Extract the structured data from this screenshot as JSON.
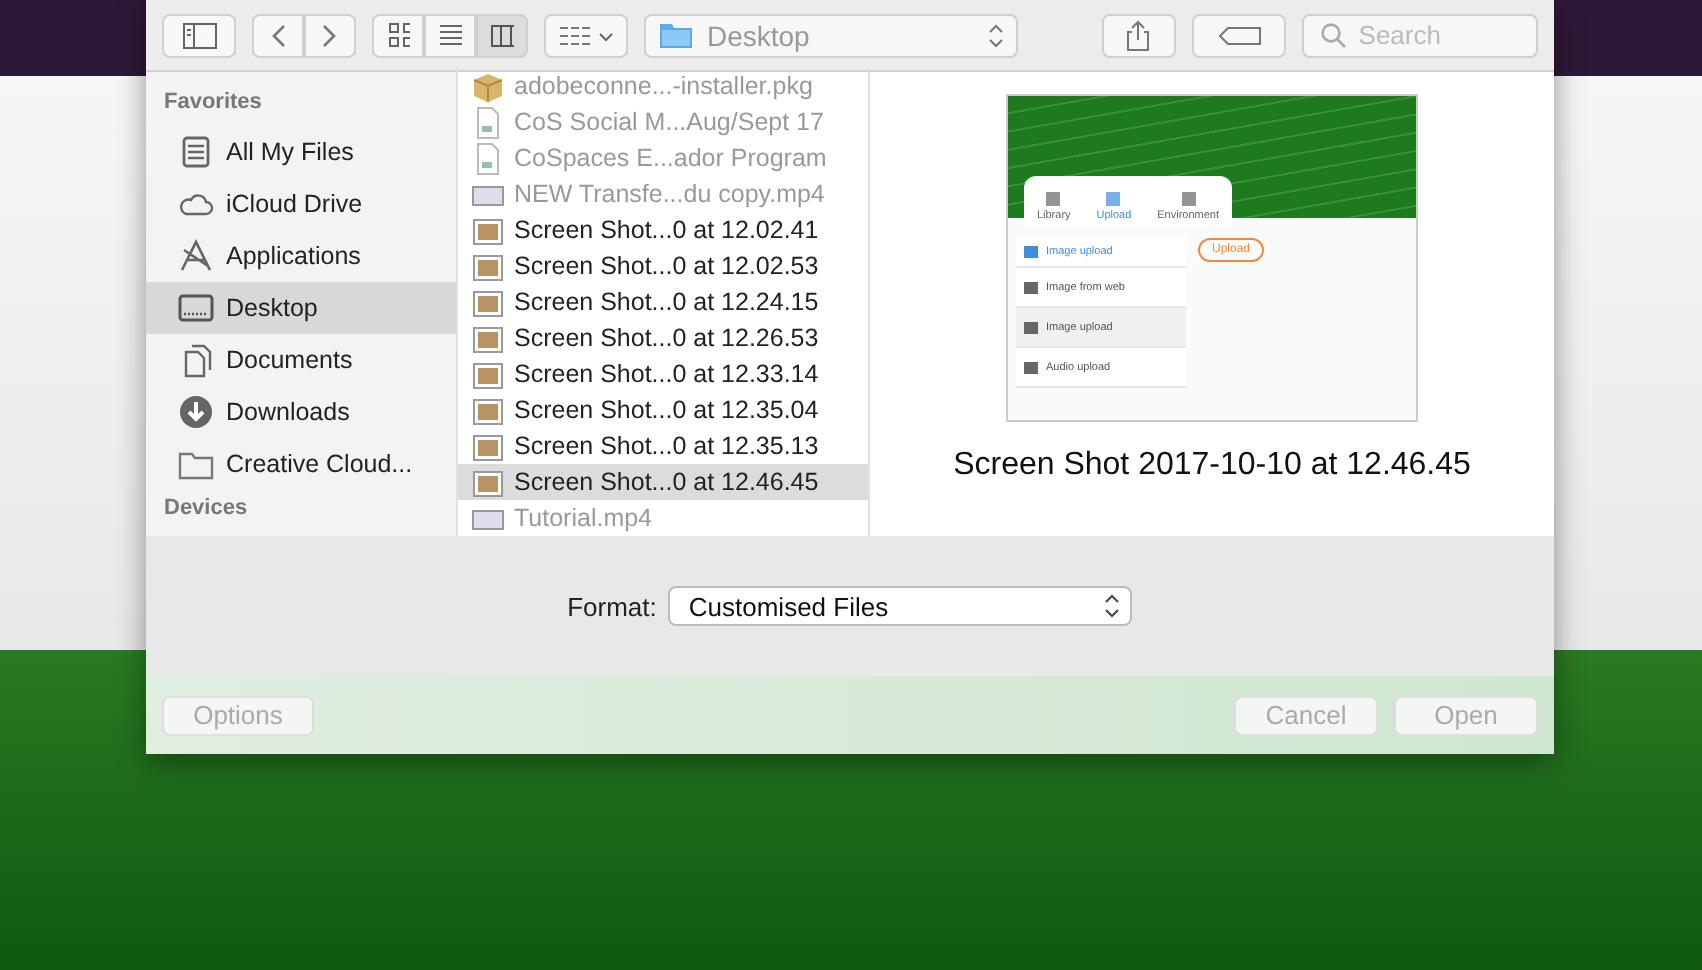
{
  "toolbar": {
    "location": "Desktop",
    "search_placeholder": "Search",
    "view_modes": [
      {
        "kind": "icons",
        "selected": false
      },
      {
        "kind": "list",
        "selected": false
      },
      {
        "kind": "columns",
        "selected": true
      }
    ]
  },
  "sidebar": {
    "sections": [
      {
        "heading": "Favorites",
        "items": [
          {
            "label": "All My Files",
            "kind": "files",
            "selected": false
          },
          {
            "label": "iCloud Drive",
            "kind": "cloud",
            "selected": false
          },
          {
            "label": "Applications",
            "kind": "apps",
            "selected": false
          },
          {
            "label": "Desktop",
            "kind": "desktop",
            "selected": true
          },
          {
            "label": "Documents",
            "kind": "docs",
            "selected": false
          },
          {
            "label": "Downloads",
            "kind": "download",
            "selected": false
          },
          {
            "label": "Creative Cloud...",
            "kind": "folder",
            "selected": false
          }
        ]
      },
      {
        "heading": "Devices"
      }
    ]
  },
  "files": [
    {
      "name": "adobeconne...-installer.pkg",
      "kind": "package",
      "disabled": true,
      "selected": false
    },
    {
      "name": "CoS Social M...Aug/Sept 17",
      "kind": "doc",
      "disabled": true,
      "selected": false
    },
    {
      "name": "CoSpaces E...ador Program",
      "kind": "doc",
      "disabled": true,
      "selected": false
    },
    {
      "name": "NEW Transfe...du copy.mp4",
      "kind": "video",
      "disabled": true,
      "selected": false
    },
    {
      "name": "Screen Shot...0 at 12.02.41",
      "kind": "image",
      "disabled": false,
      "selected": false
    },
    {
      "name": "Screen Shot...0 at 12.02.53",
      "kind": "image",
      "disabled": false,
      "selected": false
    },
    {
      "name": "Screen Shot...0 at 12.24.15",
      "kind": "image",
      "disabled": false,
      "selected": false
    },
    {
      "name": "Screen Shot...0 at 12.26.53",
      "kind": "image",
      "disabled": false,
      "selected": false
    },
    {
      "name": "Screen Shot...0 at 12.33.14",
      "kind": "image",
      "disabled": false,
      "selected": false
    },
    {
      "name": "Screen Shot...0 at 12.35.04",
      "kind": "image",
      "disabled": false,
      "selected": false
    },
    {
      "name": "Screen Shot...0 at 12.35.13",
      "kind": "image",
      "disabled": false,
      "selected": false
    },
    {
      "name": "Screen Shot...0 at 12.46.45",
      "kind": "image",
      "disabled": false,
      "selected": true
    },
    {
      "name": "Tutorial.mp4",
      "kind": "video",
      "disabled": true,
      "selected": false
    }
  ],
  "preview": {
    "title": "Screen Shot 2017-10-10 at 12.46.45",
    "screenshot": {
      "tabs": [
        {
          "label": "Library",
          "selected": false
        },
        {
          "label": "Upload",
          "selected": true
        },
        {
          "label": "Environment",
          "selected": false
        }
      ],
      "menu_header": "Image upload",
      "upload_button": "Upload",
      "menu_items": [
        {
          "label": "Image from web",
          "selected": false
        },
        {
          "label": "Image upload",
          "selected": true
        },
        {
          "label": "Audio upload",
          "selected": false
        }
      ]
    }
  },
  "format": {
    "label": "Format:",
    "value": "Customised Files"
  },
  "buttons": [
    {
      "label": "Options",
      "disabled": true
    },
    {
      "label": "Cancel",
      "disabled": true
    },
    {
      "label": "Open",
      "disabled": true
    }
  ]
}
